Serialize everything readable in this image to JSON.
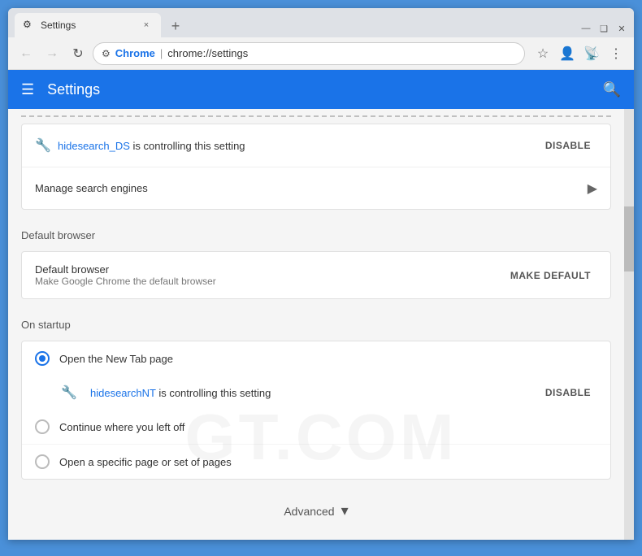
{
  "browser": {
    "tab_title": "Settings",
    "tab_favicon": "⚙",
    "tab_close": "×",
    "new_tab": "+",
    "window_minimize": "—",
    "window_maximize": "❑",
    "window_close": "✕"
  },
  "navbar": {
    "back": "←",
    "forward": "→",
    "reload": "↻",
    "chrome_label": "Chrome",
    "url": "chrome://settings",
    "url_separator": "|",
    "star": "☆",
    "person_icon": "👤",
    "more_icon": "⋮"
  },
  "header": {
    "menu_icon": "☰",
    "title": "Settings",
    "search_icon": "🔍"
  },
  "search_section": {
    "controlling_text": "hidesearch_DS is controlling this setting",
    "extension_name": "hidesearch_DS",
    "extension_icon": "🔧",
    "disable_label": "DISABLE",
    "manage_label": "Manage search engines",
    "manage_arrow": "▶"
  },
  "default_browser_section": {
    "title": "Default browser",
    "row_title": "Default browser",
    "row_subtitle": "Make Google Chrome the default browser",
    "make_default_label": "MAKE DEFAULT"
  },
  "on_startup_section": {
    "title": "On startup",
    "options": [
      {
        "label": "Open the New Tab page",
        "selected": true
      },
      {
        "label": "Continue where you left off",
        "selected": false
      },
      {
        "label": "Open a specific page or set of pages",
        "selected": false
      }
    ],
    "extension_name": "hidesearchNT",
    "extension_icon": "🔧",
    "controlling_text": "hidesearchNT is controlling this setting",
    "disable_label": "DISABLE"
  },
  "advanced": {
    "label": "Advanced",
    "arrow": "▾"
  },
  "watermark": {
    "text": "GT.COM"
  }
}
